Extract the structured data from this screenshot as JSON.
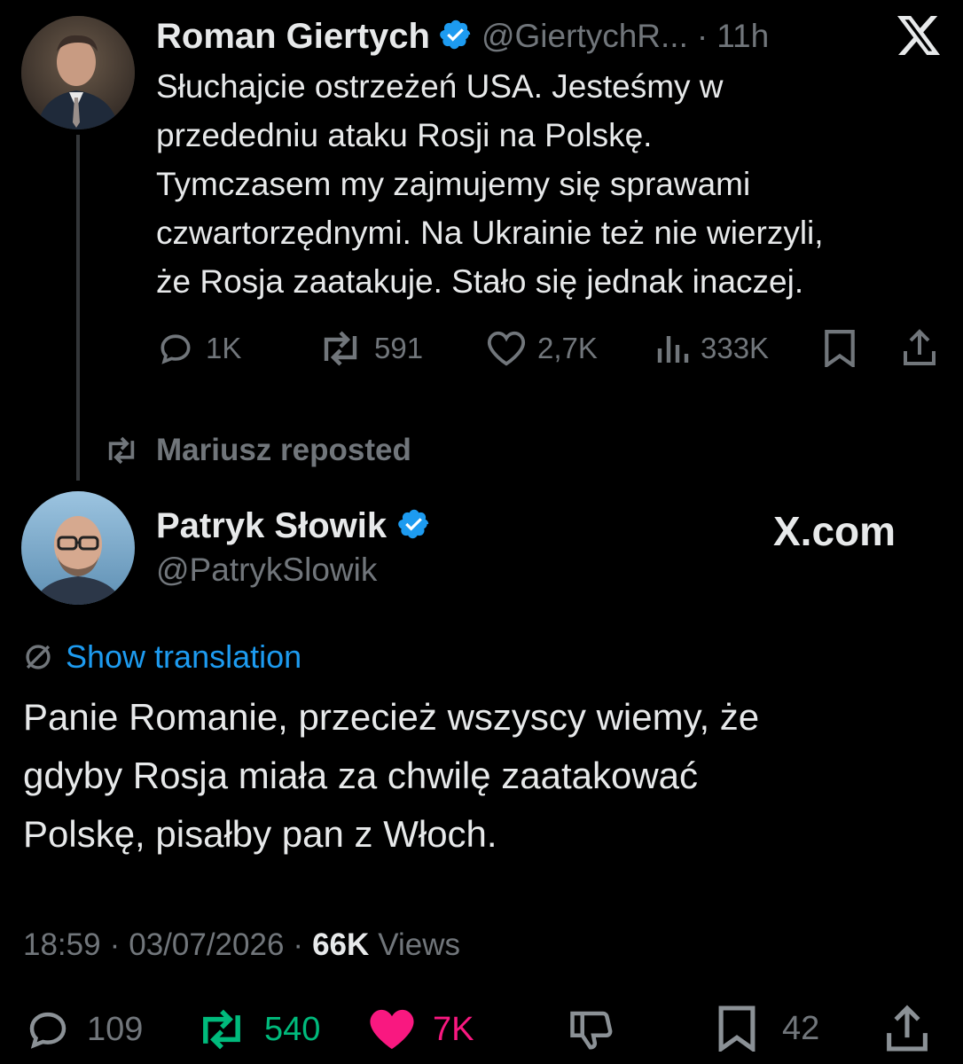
{
  "first_tweet": {
    "author": "Roman Giertych",
    "handle": "@GiertychR...",
    "separator": "·",
    "time": "11h",
    "text_lines": [
      "Słuchajcie ostrzeżeń USA. Jesteśmy w",
      "przededniu ataku Rosji na Polskę.",
      "Tymczasem my zajmujemy się sprawami",
      "czwartorzędnymi. Na Ukrainie też nie wierzyli,",
      "że Rosja zaatakuje. Stało się jednak inaczej."
    ],
    "actions": {
      "replies": "1K",
      "reposts": "591",
      "likes": "2,7K",
      "views": "333K"
    }
  },
  "repost_label": "Mariusz reposted",
  "second_tweet": {
    "author": "Patryk Słowik",
    "handle": "@PatrykSlowik",
    "brand": "X.com",
    "show_translation": "Show translation",
    "text_lines": [
      "Panie Romanie, przecież wszyscy wiemy, że",
      "gdyby Rosja miała za chwilę zaatakować",
      "Polskę, pisałby pan z Włoch."
    ],
    "meta": {
      "time": "18:59",
      "date": "03/07/2026",
      "separator": "·",
      "views_count": "66K",
      "views_label": "Views"
    },
    "actions": {
      "replies": "109",
      "reposts": "540",
      "likes": "7K",
      "bookmarks": "42"
    }
  },
  "colors": {
    "background": "#000000",
    "text": "#e7e9ea",
    "muted": "#71767b",
    "verified": "#1d9bf0",
    "link": "#1d9bf0",
    "repost_green": "#00ba7c",
    "like_pink": "#f91880"
  },
  "icons": [
    "x-logo-icon",
    "verified-badge-icon",
    "reply-icon",
    "repost-icon",
    "like-icon",
    "views-icon",
    "bookmark-icon",
    "share-icon",
    "translate-icon",
    "downvote-icon"
  ]
}
